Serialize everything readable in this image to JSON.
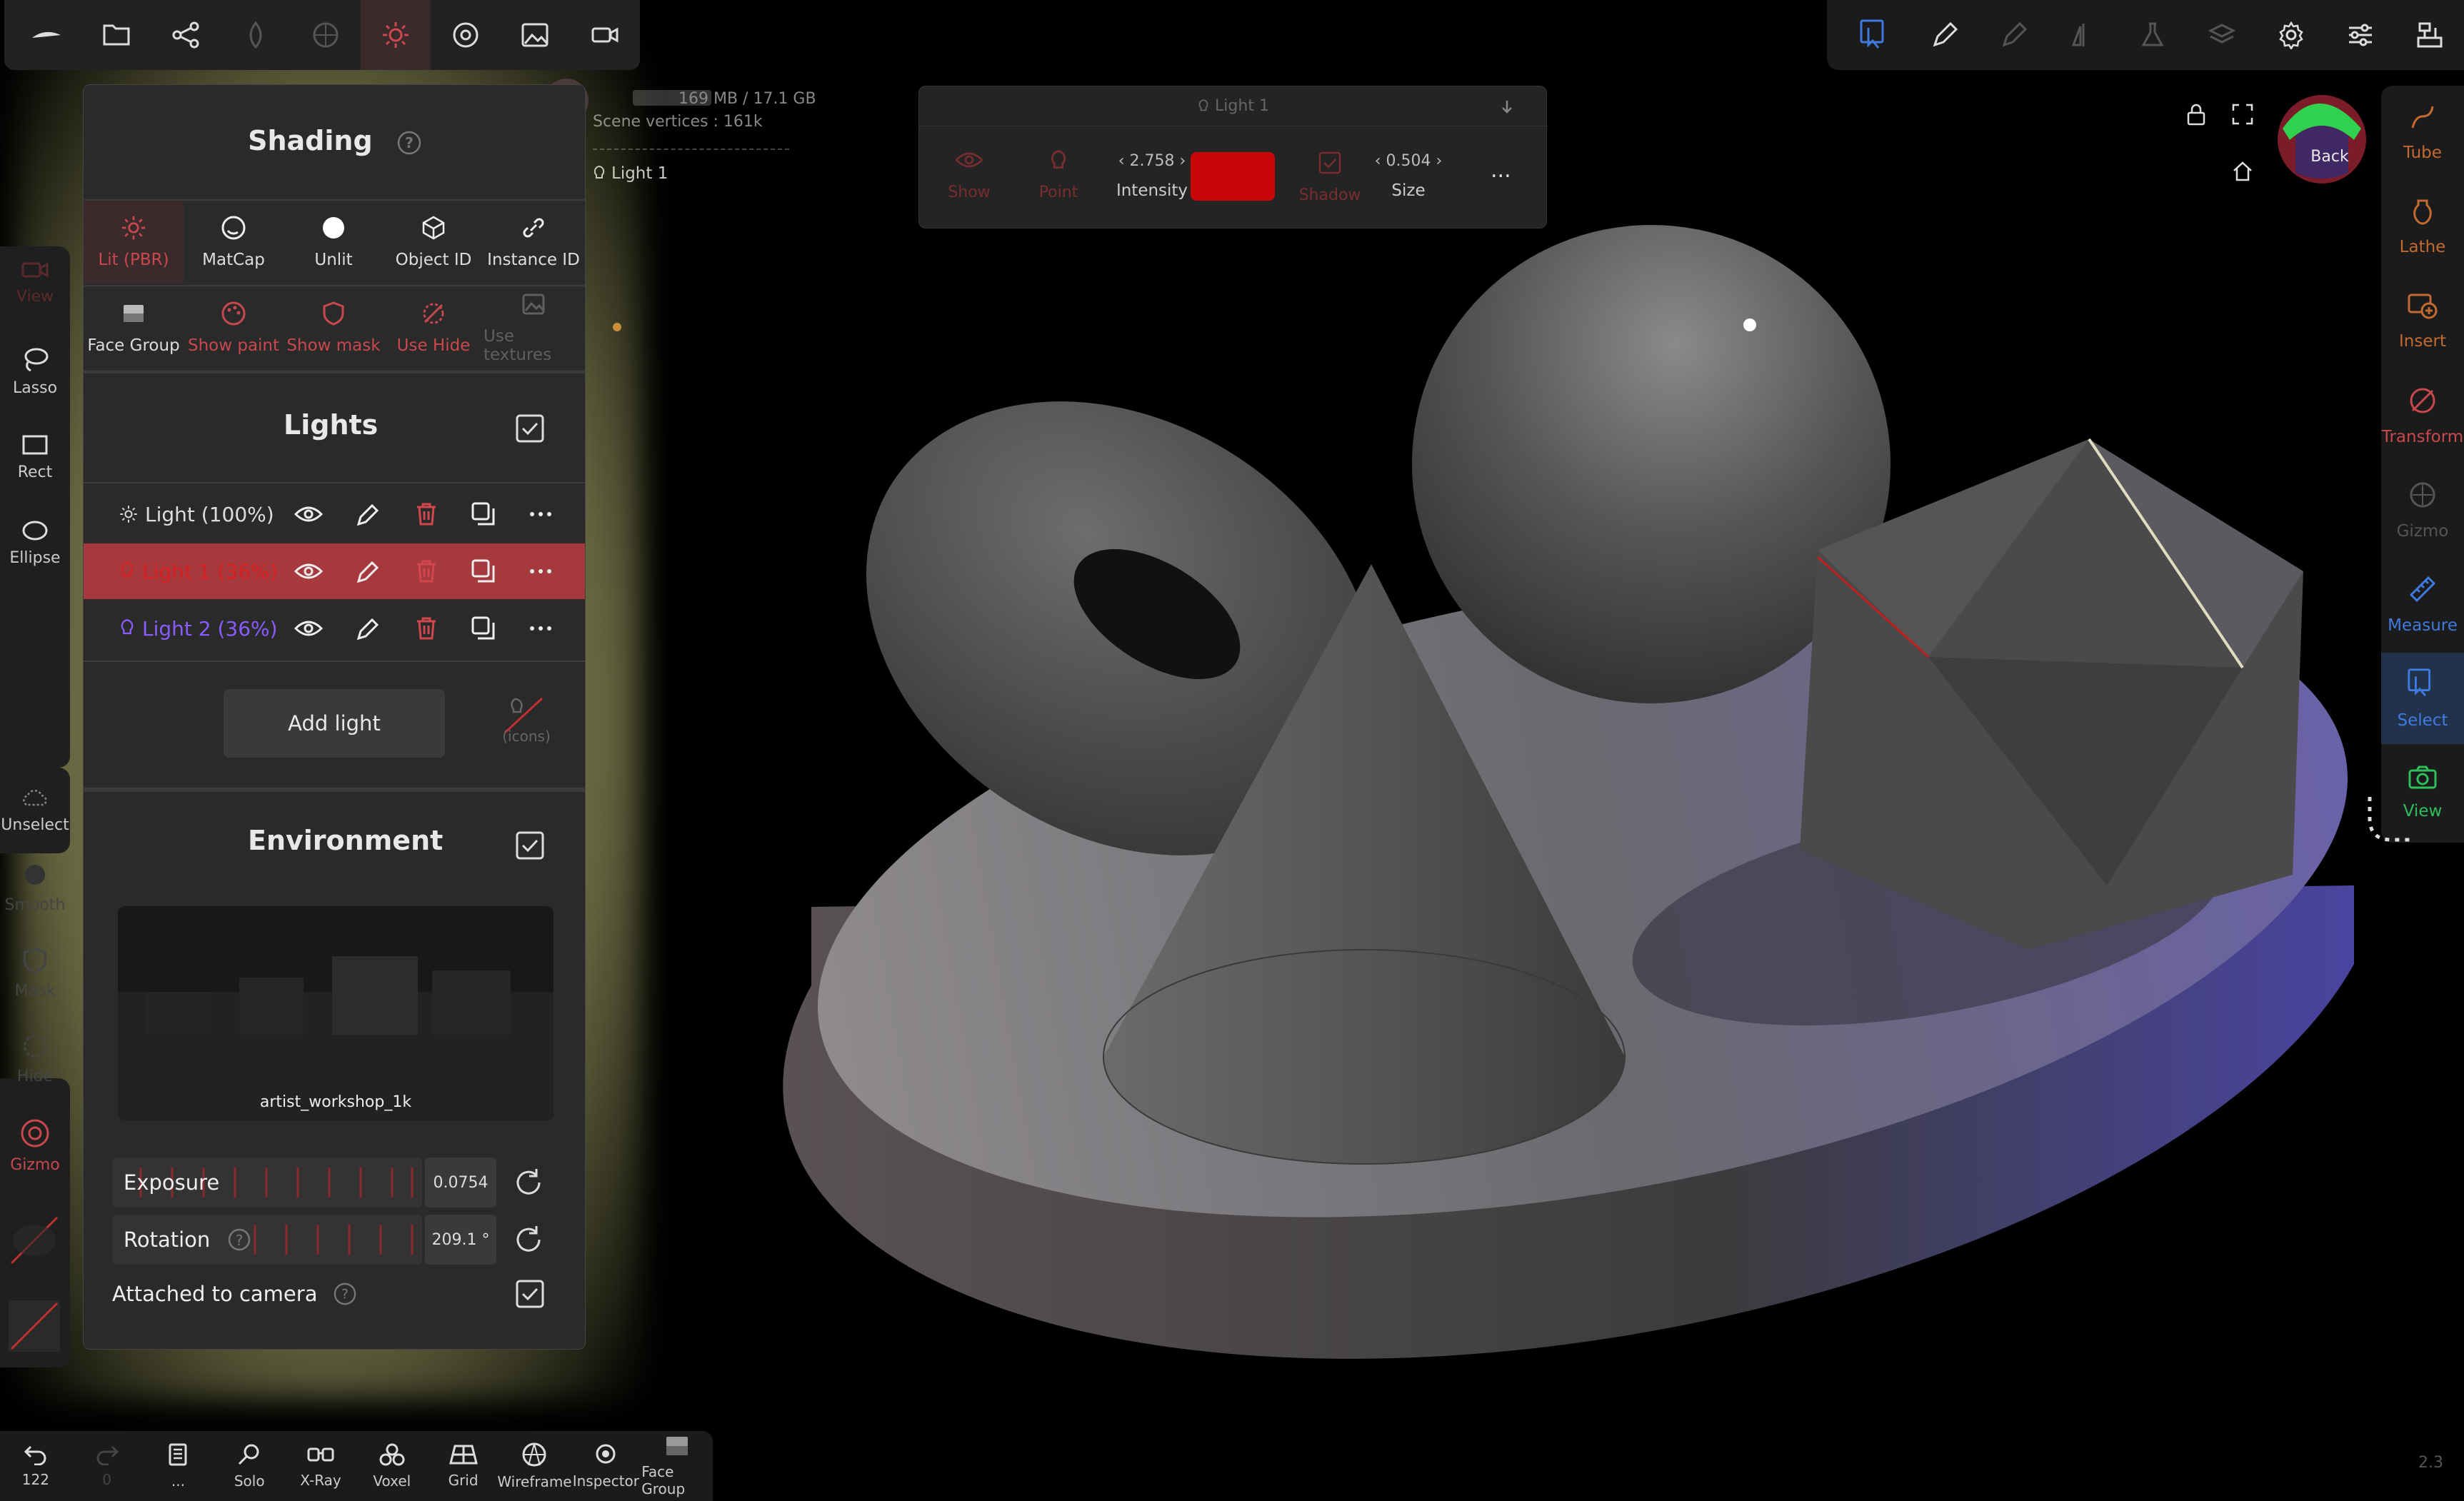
{
  "stats": {
    "memory": "169 MB / 17.1 GB",
    "vertices": "Scene vertices : 161k",
    "selected_light": "Light 1"
  },
  "shading": {
    "title": "Shading",
    "modes": [
      {
        "label": "Lit (PBR)",
        "icon": "sun-icon"
      },
      {
        "label": "MatCap",
        "icon": "matcap-icon"
      },
      {
        "label": "Unlit",
        "icon": "circle-icon"
      },
      {
        "label": "Object ID",
        "icon": "cube-icon"
      },
      {
        "label": "Instance ID",
        "icon": "link-icon"
      }
    ],
    "options": [
      {
        "label": "Face Group",
        "icon": "facegroup-icon"
      },
      {
        "label": "Show paint",
        "icon": "palette-icon"
      },
      {
        "label": "Show mask",
        "icon": "shield-icon"
      },
      {
        "label": "Use Hide",
        "icon": "hide-icon"
      },
      {
        "label": "Use textures",
        "icon": "image-icon"
      }
    ]
  },
  "lights": {
    "title": "Lights",
    "items": [
      {
        "name": "Light (100%)"
      },
      {
        "name": "Light 1 (36%)"
      },
      {
        "name": "Light 2 (36%)"
      }
    ],
    "add_label": "Add light",
    "icons_label": "(icons)"
  },
  "environment": {
    "title": "Environment",
    "preview": "artist_workshop_1k",
    "exposure_label": "Exposure",
    "exposure_value": "0.0754",
    "rotation_label": "Rotation",
    "rotation_value": "209.1 °",
    "attached_label": "Attached to camera"
  },
  "light_popup": {
    "title": "Light 1",
    "show": "Show",
    "point": "Point",
    "intensity_label": "Intensity",
    "intensity_value": "2.758",
    "color": "#c80808",
    "shadow": "Shadow",
    "size_label": "Size",
    "size_value": "0.504",
    "more": "..."
  },
  "left_tools": [
    {
      "label": "View"
    },
    {
      "label": "Lasso"
    },
    {
      "label": "Rect"
    },
    {
      "label": "Ellipse"
    },
    {
      "label": "Unselect"
    },
    {
      "label": "Smooth"
    },
    {
      "label": "Mask"
    },
    {
      "label": "Hide"
    },
    {
      "label": "Gizmo"
    }
  ],
  "right_tools": [
    {
      "label": "Tube"
    },
    {
      "label": "Lathe"
    },
    {
      "label": "Insert"
    },
    {
      "label": "Transform"
    },
    {
      "label": "Gizmo"
    },
    {
      "label": "Measure"
    },
    {
      "label": "Select"
    },
    {
      "label": "View"
    }
  ],
  "bottom": [
    {
      "label": "122",
      "icon": "undo-icon"
    },
    {
      "label": "0",
      "icon": "redo-icon"
    },
    {
      "label": "...",
      "icon": "files-icon"
    },
    {
      "label": "Solo",
      "icon": "search-icon"
    },
    {
      "label": "X-Ray",
      "icon": "xray-icon"
    },
    {
      "label": "Voxel",
      "icon": "voxel-icon"
    },
    {
      "label": "Grid",
      "icon": "grid-icon"
    },
    {
      "label": "Wireframe",
      "icon": "wireframe-icon"
    },
    {
      "label": "Inspector",
      "icon": "inspector-icon"
    },
    {
      "label": "Face Group",
      "icon": "facegroup-icon"
    }
  ],
  "gizmo_label": "Back",
  "version": "2.3",
  "colors": {
    "accent": "#c9484e",
    "panel": "#2a2a2a",
    "selected_row": "#a5393d",
    "light2": "#8a5cff"
  }
}
